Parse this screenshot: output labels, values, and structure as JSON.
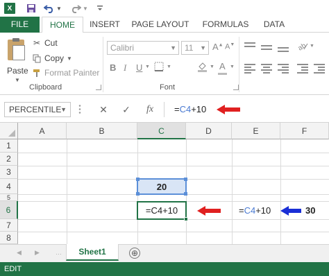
{
  "qat": {
    "icons": [
      "excel-logo",
      "save-icon",
      "undo-icon",
      "undo-dropdown",
      "redo-icon",
      "redo-dropdown",
      "customize-qat"
    ]
  },
  "tabs": [
    {
      "label": "FILE"
    },
    {
      "label": "HOME"
    },
    {
      "label": "INSERT"
    },
    {
      "label": "PAGE LAYOUT"
    },
    {
      "label": "FORMULAS"
    },
    {
      "label": "DATA"
    }
  ],
  "active_tab": "HOME",
  "ribbon": {
    "clipboard": {
      "paste_label": "Paste",
      "cut_label": "Cut",
      "copy_label": "Copy",
      "format_painter_label": "Format Painter",
      "group_label": "Clipboard"
    },
    "font": {
      "font_name": "Calibri",
      "font_size": "11",
      "group_label": "Font"
    }
  },
  "formula_bar": {
    "name_box": "PERCENTILE",
    "cancel_glyph": "✕",
    "enter_glyph": "✓",
    "fx_label": "fx",
    "formula_prefix": "=",
    "formula_ref": "C4",
    "formula_suffix": "+10"
  },
  "grid": {
    "columns": [
      "A",
      "B",
      "C",
      "D",
      "E",
      "F"
    ],
    "selected_column": "C",
    "rows": [
      "1",
      "2",
      "3",
      "4",
      "5",
      "6",
      "7",
      "8"
    ],
    "selected_row": "6",
    "cells": {
      "C4": "20",
      "C6": "=C4+10",
      "E6_prefix": "=",
      "E6_ref": "C4",
      "E6_suffix": "+10",
      "F6": "30"
    }
  },
  "annotations": {
    "arrow_red": "#e02020",
    "arrow_blue": "#1a2fd6"
  },
  "sheets": [
    {
      "name": "Sheet1"
    }
  ],
  "add_sheet_glyph": "⊕",
  "status": {
    "mode": "EDIT"
  },
  "colors": {
    "excel_green": "#217346",
    "ref_blue": "#4a7ad2",
    "ref_fill": "#d9e5f6"
  }
}
